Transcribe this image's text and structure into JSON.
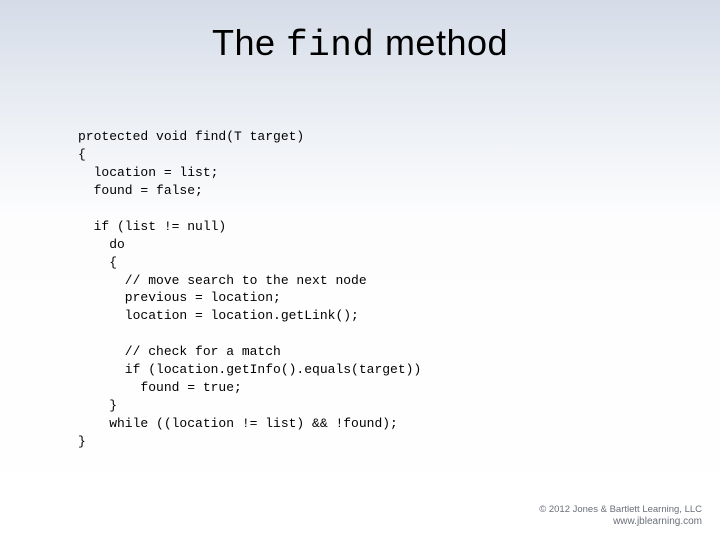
{
  "title": {
    "prefix": "The ",
    "code": "find",
    "suffix": " method"
  },
  "code": {
    "l01": "protected void find(T target)",
    "l02": "{",
    "l03": "  location = list;",
    "l04": "  found = false;",
    "l05": "",
    "l06": "  if (list != null)",
    "l07": "    do",
    "l08": "    {",
    "l09": "      // move search to the next node",
    "l10": "      previous = location;",
    "l11": "      location = location.getLink();",
    "l12": "",
    "l13": "      // check for a match",
    "l14": "      if (location.getInfo().equals(target))",
    "l15": "        found = true;",
    "l16": "    }",
    "l17": "    while ((location != list) && !found);",
    "l18": "}"
  },
  "footer": {
    "copyright": "© 2012 Jones & Bartlett Learning, LLC",
    "url": "www.jblearning.com"
  }
}
